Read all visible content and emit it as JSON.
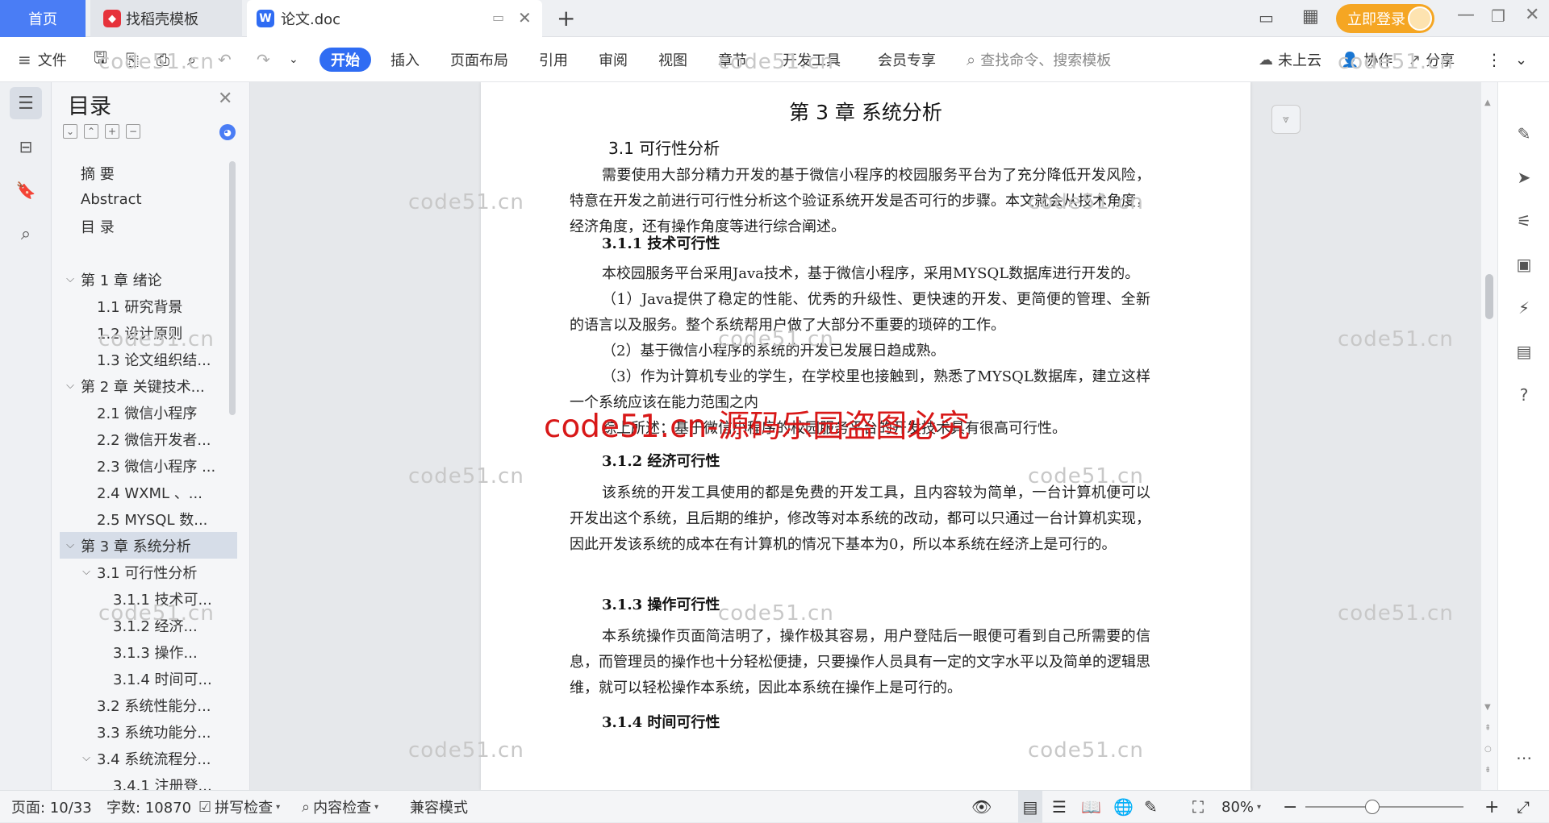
{
  "tabs": {
    "home": "首页",
    "template": "找稻壳模板",
    "document": "论文.doc",
    "new_tab": "+"
  },
  "titlebar": {
    "login": "立即登录"
  },
  "toolbar": {
    "file": "文件",
    "ribbon": [
      "开始",
      "插入",
      "页面布局",
      "引用",
      "审阅",
      "视图",
      "章节",
      "开发工具",
      "会员专享"
    ],
    "search_placeholder": "查找命令、搜索模板",
    "cloud": "未上云",
    "collab": "协作",
    "share": "分享"
  },
  "toc": {
    "title": "目录",
    "items": [
      {
        "label": "摘  要",
        "level": 0
      },
      {
        "label": "Abstract",
        "level": 0
      },
      {
        "label": "目    录",
        "level": 0
      },
      {
        "label": "",
        "level": 0
      },
      {
        "label": "第 1 章    绪论",
        "level": 0,
        "arrow": "v"
      },
      {
        "label": "1.1 研究背景",
        "level": 1
      },
      {
        "label": "1.2 设计原则",
        "level": 1
      },
      {
        "label": "1.3 论文组织结...",
        "level": 1
      },
      {
        "label": "第 2 章    关键技术...",
        "level": 0,
        "arrow": "v"
      },
      {
        "label": "2.1  微信小程序",
        "level": 1
      },
      {
        "label": "2.2  微信开发者...",
        "level": 1
      },
      {
        "label": "2.3 微信小程序 ...",
        "level": 1
      },
      {
        "label": "2.4 WXML  、...",
        "level": 1
      },
      {
        "label": "2.5 MYSQL 数...",
        "level": 1
      },
      {
        "label": "第 3 章    系统分析",
        "level": 0,
        "arrow": "v",
        "active": true
      },
      {
        "label": "3.1  可行性分析",
        "level": 1,
        "arrow": "v"
      },
      {
        "label": "3.1.1 技术可...",
        "level": 2
      },
      {
        "label": "3.1.2  经济...",
        "level": 2
      },
      {
        "label": "3.1.3   操作...",
        "level": 2
      },
      {
        "label": "3.1.4 时间可...",
        "level": 2
      },
      {
        "label": "3.2  系统性能分...",
        "level": 1
      },
      {
        "label": "3.3  系统功能分...",
        "level": 1
      },
      {
        "label": "3.4  系统流程分...",
        "level": 1,
        "arrow": "v"
      },
      {
        "label": "3.4.1 注册登...",
        "level": 2
      }
    ]
  },
  "document": {
    "chapter": "第 3 章    系统分析",
    "s31": "3.1  可行性分析",
    "p1": "需要使用大部分精力开发的基于微信小程序的校园服务平台为了充分降低开发风险，特意在开发之前进行可行性分析这个验证系统开发是否可行的步骤。本文就会从技术角度，经济角度，还有操作角度等进行综合阐述。",
    "s311": "3.1.1 技术可行性",
    "p2": "本校园服务平台采用Java技术，基于微信小程序，采用MYSQL数据库进行开发的。",
    "p3": "（1）Java提供了稳定的性能、优秀的升级性、更快速的开发、更简便的管理、全新的语言以及服务。整个系统帮用户做了大部分不重要的琐碎的工作。",
    "p4": "（2）基于微信小程序的系统的开发已发展日趋成熟。",
    "p5": "（3）作为计算机专业的学生，在学校里也接触到，熟悉了MYSQL数据库，建立这样一个系统应该在能力范围之内",
    "p6": "综上所述：基于微信小程序的校园服务平台的开发技术具有很高可行性。",
    "s312": "3.1.2  经济可行性",
    "p7": "该系统的开发工具使用的都是免费的开发工具，且内容较为简单，一台计算机便可以开发出这个系统，且后期的维护，修改等对本系统的改动，都可以只通过一台计算机实现，因此开发该系统的成本在有计算机的情况下基本为0，所以本系统在经济上是可行的。",
    "s313": "3.1.3  操作可行性",
    "p8": "本系统操作页面简洁明了，操作极其容易，用户登陆后一眼便可看到自己所需要的信息，而管理员的操作也十分轻松便捷，只要操作人员具有一定的文字水平以及简单的逻辑思维，就可以轻松操作本系统，因此本系统在操作上是可行的。",
    "s314": "3.1.4 时间可行性"
  },
  "watermark": {
    "text": "code51.cn",
    "red": "code51.cn-源码乐园盗图必究"
  },
  "statusbar": {
    "page": "页面: 10/33",
    "words": "字数: 10870",
    "spell": "拼写检查",
    "content": "内容检查",
    "compat": "兼容模式",
    "zoom": "80%"
  }
}
